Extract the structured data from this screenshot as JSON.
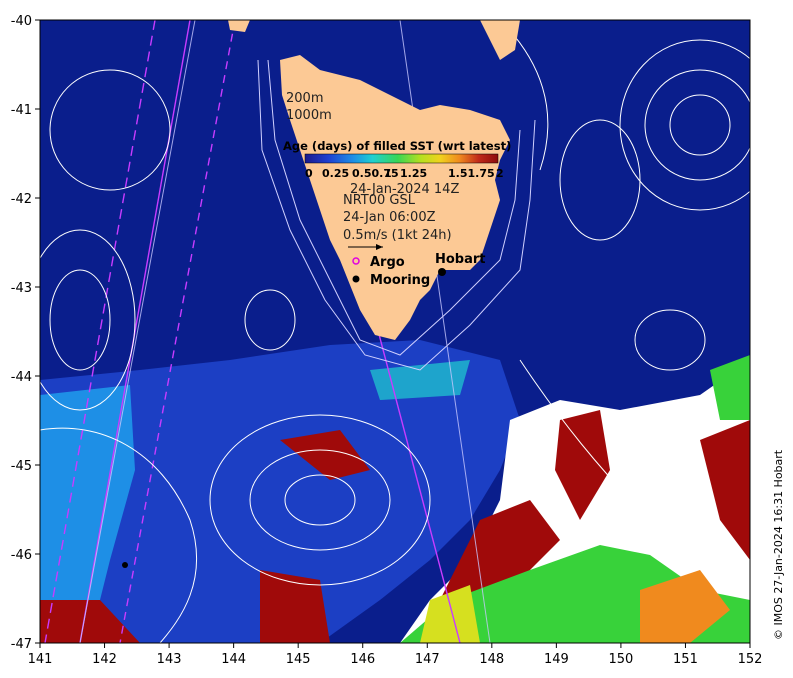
{
  "map": {
    "lon_range": [
      141,
      152
    ],
    "lat_range": [
      -47,
      -40
    ],
    "x_ticks": [
      "141",
      "142",
      "143",
      "144",
      "145",
      "146",
      "147",
      "148",
      "149",
      "150",
      "151",
      "152"
    ],
    "y_ticks": [
      "-40",
      "-41",
      "-42",
      "-43",
      "-44",
      "-45",
      "-46",
      "-47"
    ]
  },
  "legend": {
    "isobath_labels": [
      "200m",
      "1000m"
    ],
    "colorbar_title": "Age (days) of filled SST (wrt latest)",
    "colorbar_ticks": [
      "0",
      "0.25",
      "0.50.75",
      "1",
      "1.25",
      "1.51.75",
      "2"
    ],
    "colorbar_colors": [
      "#1a1a8c",
      "#1f3fd0",
      "#1e8fe6",
      "#1fd0d0",
      "#39d655",
      "#b6e01f",
      "#f0d21e",
      "#f08a1e",
      "#c0291a",
      "#8c0c0c"
    ],
    "sst_time": "24-Jan-2024 14Z",
    "current_source": "NRT00 GSL",
    "current_time": "24-Jan 06:00Z",
    "scale_label": "0.5m/s (1kt 24h)",
    "argo_label": "Argo",
    "mooring_label": "Mooring"
  },
  "places": {
    "hobart": "Hobart"
  },
  "credit": "© IMOS 27-Jan-2024 16:31 Hobart",
  "colors": {
    "ocean_deep": "#0a1e8c",
    "ocean_mid": "#1c3fc4",
    "land": "#fcc995",
    "contour": "#ffffff",
    "argo_track": "#c83cff",
    "missing": "#ffffff",
    "old_sst": "#a00a0a",
    "green_sst": "#38d23a"
  }
}
